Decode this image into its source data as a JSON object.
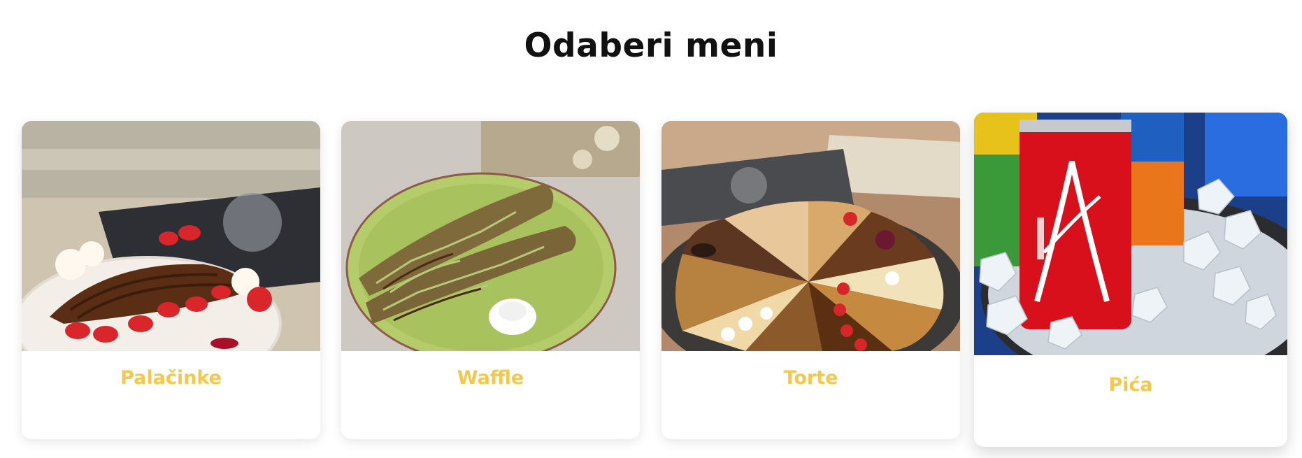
{
  "heading": "Odaberi meni",
  "colors": {
    "label": "#f5c84c",
    "heading": "#111111",
    "card_bg": "#ffffff"
  },
  "menu": {
    "items": [
      {
        "label": "Palačinke",
        "image": "crepe-photo"
      },
      {
        "label": "Waffle",
        "image": "waffle-photo"
      },
      {
        "label": "Torte",
        "image": "cake-platter-photo"
      },
      {
        "label": "Pića",
        "image": "soda-cans-photo"
      }
    ]
  }
}
